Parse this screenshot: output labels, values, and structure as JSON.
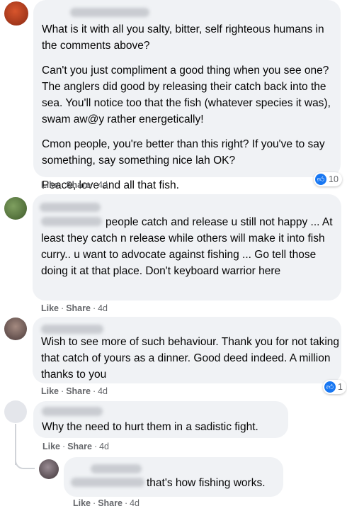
{
  "comments": [
    {
      "paragraphs": [
        "What is it with all you salty, bitter, self righteous humans in the comments above?",
        "Can't you just compliment a good thing when you see one? The anglers did good by releasing their catch back into the sea. You'll notice too that the fish (whatever species it was), swam aw@y rather energetically!",
        "Cmon people, you're better than this right? If you've to say something, say something nice lah OK?",
        "Peace, love and all that fish."
      ],
      "like": "Like",
      "share": "Share",
      "time": "4d",
      "reaction_count": "10"
    },
    {
      "text": "people catch and release u still not happy ... At least they catch n release while others will make it into fish curry.. u want to advocate against fishing ... Go tell those doing it at that place. Don't keyboard warrior here",
      "like": "Like",
      "share": "Share",
      "time": "4d"
    },
    {
      "text": "Wish to see more of such behaviour. Thank you for not taking that catch of yours as a dinner. Good deed indeed. A million thanks to you",
      "like": "Like",
      "share": "Share",
      "time": "4d",
      "reaction_count": "1"
    },
    {
      "text": "Why the need to hurt them in a sadistic fight.",
      "like": "Like",
      "share": "Share",
      "time": "4d"
    },
    {
      "text": "that's how fishing works.",
      "like": "Like",
      "share": "Share",
      "time": "4d"
    }
  ],
  "icons": {
    "reaction": "thumbs-up-icon",
    "avatar": "user-avatar"
  },
  "colors": {
    "bubble": "#f0f2f5",
    "meta": "#65676b",
    "like_blue": "#1877f2"
  }
}
